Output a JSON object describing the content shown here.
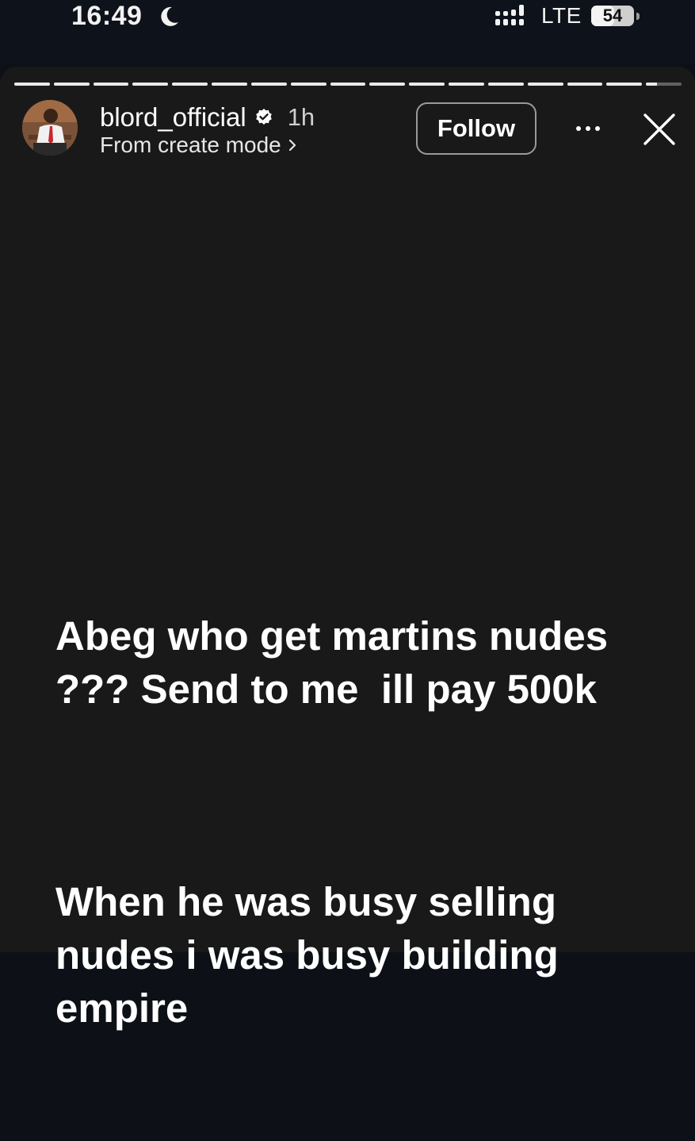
{
  "status_bar": {
    "time": "16:49",
    "moon_icon": "moon-icon",
    "signal_icon": "signal-icon",
    "network": "LTE",
    "battery_level": "54",
    "battery_fraction": 0.54
  },
  "story": {
    "segment_count": 17,
    "current_segment_index": 16,
    "current_segment_progress": 0.3,
    "header": {
      "username": "blord_official",
      "verified": true,
      "time_ago": "1h",
      "subtitle": "From create mode",
      "follow_label": "Follow",
      "more_icon": "more-horizontal-icon",
      "close_icon": "close-icon"
    },
    "paragraphs": [
      "Abeg who get martins nudes ??? Send to me  ill pay 500k",
      "When he was busy selling nudes i was busy building empire"
    ]
  },
  "colors": {
    "background": "#191919",
    "status_bar": "#0e121a",
    "text": "#ffffff",
    "secondary_text": "#cfcfcf"
  }
}
